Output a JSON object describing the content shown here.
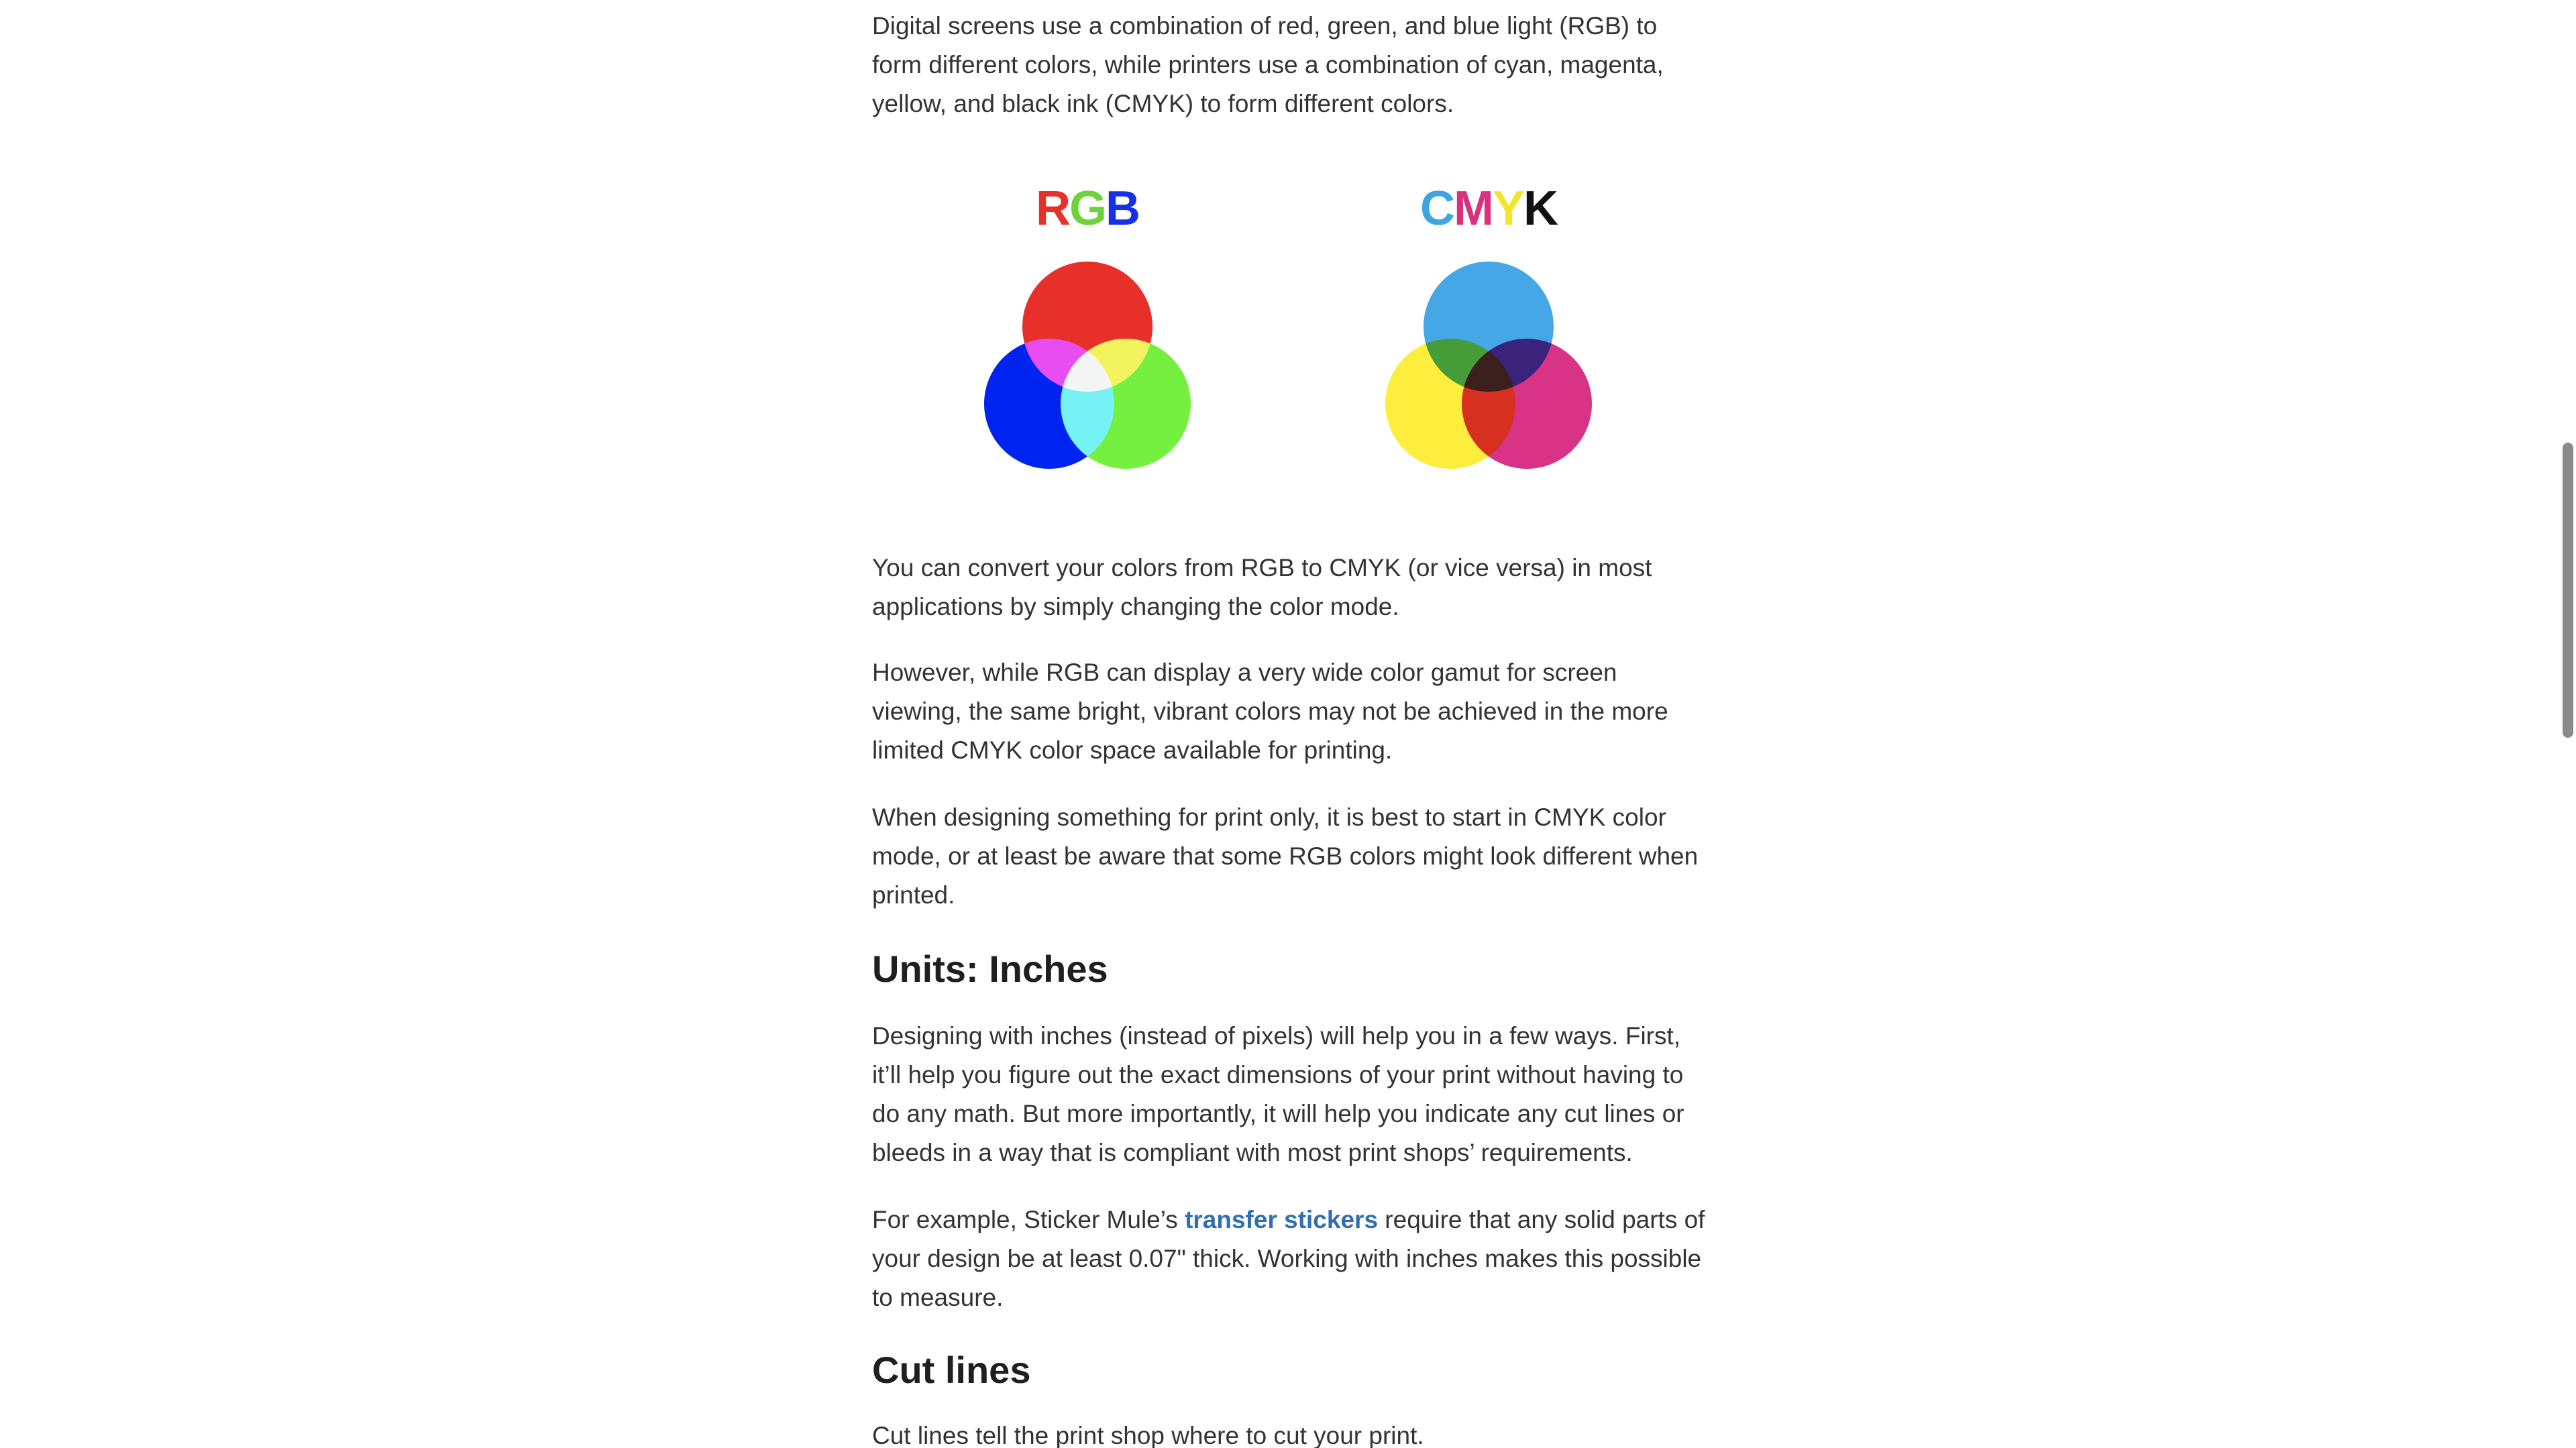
{
  "article": {
    "intro": "Digital screens use a combination of red, green, and blue light (RGB) to form different colors, while printers use a combination of cyan, magenta, yellow, and black ink (CMYK) to form different colors.",
    "figure": {
      "rgb_letters": [
        "R",
        "G",
        "B"
      ],
      "rgb_letter_colors": [
        "#e8302a",
        "#6fd13b",
        "#1630e6"
      ],
      "cmyk_letters": [
        "C",
        "M",
        "Y",
        "K"
      ],
      "cmyk_letter_colors": [
        "#3fa4e2",
        "#d9317f",
        "#f2e52d",
        "#111111"
      ],
      "rgb_circle_colors": {
        "top": "#e8302a",
        "left": "#0024f0",
        "right": "#76f040"
      },
      "cmyk_circle_colors": {
        "top": "#45a7e6",
        "left": "#fdee3e",
        "right": "#d93387"
      }
    },
    "para_convert": "You can convert your colors from RGB to CMYK (or vice versa) in most applications by simply changing the color mode.",
    "para_gamut": "However, while RGB can display a very wide color gamut for screen viewing, the same bright, vibrant colors may not be achieved in the more limited CMYK color space available for printing.",
    "para_print": "When designing something for print only, it is best to start in CMYK color mode, or at least be aware that some RGB colors might look different when printed.",
    "heading_units": "Units: Inches",
    "para_inches": "Designing with inches (instead of pixels) will help you in a few ways. First, it’ll help you figure out the exact dimensions of your print without having to do any math. But more importantly, it will help you indicate any cut lines or bleeds in a way that is compliant with most print shops’ requirements.",
    "para_example_before": "For example, Sticker Mule’s ",
    "para_example_link": "transfer stickers",
    "para_example_after": " require that any solid parts of your design be at least 0.07\" thick. Working with inches makes this possible to measure.",
    "heading_cut": "Cut lines",
    "para_cut": "Cut lines tell the print shop where to cut your print."
  },
  "colors": {
    "text": "#333333",
    "heading": "#1f1f1f",
    "link": "#2f6fb0",
    "scrollbar": "#8a8a8a"
  }
}
